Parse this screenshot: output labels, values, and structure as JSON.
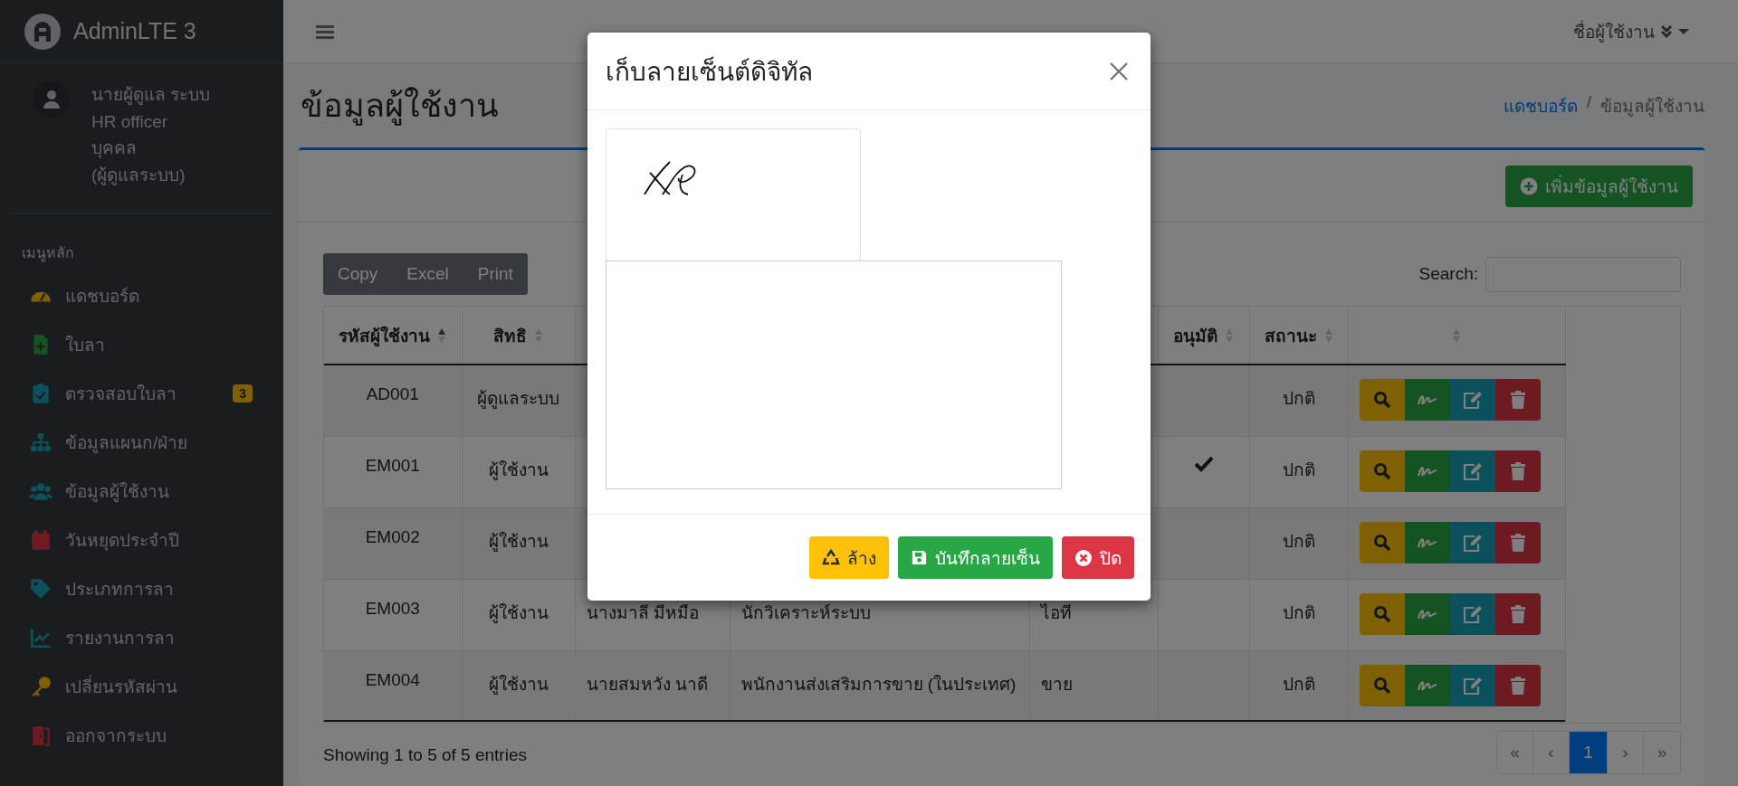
{
  "brand": {
    "title": "AdminLTE 3"
  },
  "user": {
    "lines": [
      "นายผู้ดูแล ระบบ",
      "HR officer",
      "บุคคล",
      "(ผู้ดูแลระบบ)"
    ]
  },
  "sidebar": {
    "header": "เมนูหลัก",
    "items": [
      {
        "label": "แดชบอร์ด",
        "color": "#806004"
      },
      {
        "label": "ใบลา",
        "color": "#145423"
      },
      {
        "label": "ตรวจสอบใบลา",
        "color": "#0c515c",
        "badge": "3"
      },
      {
        "label": "ข้อมูลแผนก/ฝ่าย",
        "color": "#0c515c"
      },
      {
        "label": "ข้อมูลผู้ใช้งาน",
        "color": "#0c515c"
      },
      {
        "label": "วันหยุดประจำปี",
        "color": "#6e1b23"
      },
      {
        "label": "ประเภทการลา",
        "color": "#0c515c"
      },
      {
        "label": "รายงานการลา",
        "color": "#0c515c"
      },
      {
        "label": "เปลี่ยนรหัสผ่าน",
        "color": "#806004"
      },
      {
        "label": "ออกจากระบบ",
        "color": "#6e1b23"
      }
    ]
  },
  "navbar": {
    "user_menu": "ชื่อผู้ใช้งาน"
  },
  "page": {
    "title": "ข้อมูลผู้ใช้งาน",
    "breadcrumb_separator": "/",
    "breadcrumb": [
      {
        "label": "แดชบอร์ด",
        "link": true
      },
      {
        "label": "ข้อมูลผู้ใช้งาน",
        "link": false
      }
    ]
  },
  "card": {
    "add_button": "เพิ่มข้อมูลผู้ใช้งาน",
    "export_buttons": [
      "Copy",
      "Excel",
      "Print"
    ],
    "search_label": "Search:"
  },
  "table": {
    "columns": [
      {
        "label": "รหัสผู้ใช้งาน",
        "sorted": true
      },
      {
        "label": "สิทธิ",
        "sorted": false
      },
      {
        "label": "อนุมัติ",
        "sorted": false
      },
      {
        "label": "สถานะ",
        "sorted": false
      },
      {
        "sorted": false
      }
    ],
    "rows": [
      {
        "id": "AD001",
        "role": "ผู้ดูแลระบบ",
        "approved": false,
        "status": "ปกติ"
      },
      {
        "id": "EM001",
        "role": "ผู้ใช้งาน",
        "approved": true,
        "status": "ปกติ"
      },
      {
        "id": "EM002",
        "role": "ผู้ใช้งาน",
        "approved": false,
        "status": "ปกติ"
      },
      {
        "id": "EM003",
        "role": "ผู้ใช้งาน",
        "name": "นางมาลี มีหมือ",
        "position": "นักวิเคราะห์ระบบ",
        "department": "ไอที",
        "approved": false,
        "status": "ปกติ"
      },
      {
        "id": "EM004",
        "role": "ผู้ใช้งาน",
        "name": "นายสมหวัง นาดี",
        "position": "พนักงานส่งเสริมการขาย (ในประเทศ)",
        "department": "ขาย",
        "approved": false,
        "status": "ปกติ"
      }
    ]
  },
  "footer": {
    "info": "Showing 1 to 5 of 5 entries",
    "pages": [
      {
        "label": "«",
        "selected": false
      },
      {
        "label": "‹",
        "selected": false
      },
      {
        "label": "1",
        "selected": true
      },
      {
        "label": "›",
        "selected": false
      },
      {
        "label": "»",
        "selected": false
      }
    ]
  },
  "modal": {
    "title": "เก็บลายเซ็นต์ดิจิทัล",
    "buttons": [
      {
        "label": "ล้าง",
        "kind": "clear"
      },
      {
        "label": "บันทึกลายเซ็น",
        "kind": "save"
      },
      {
        "label": "ปิด",
        "kind": "close"
      }
    ]
  }
}
